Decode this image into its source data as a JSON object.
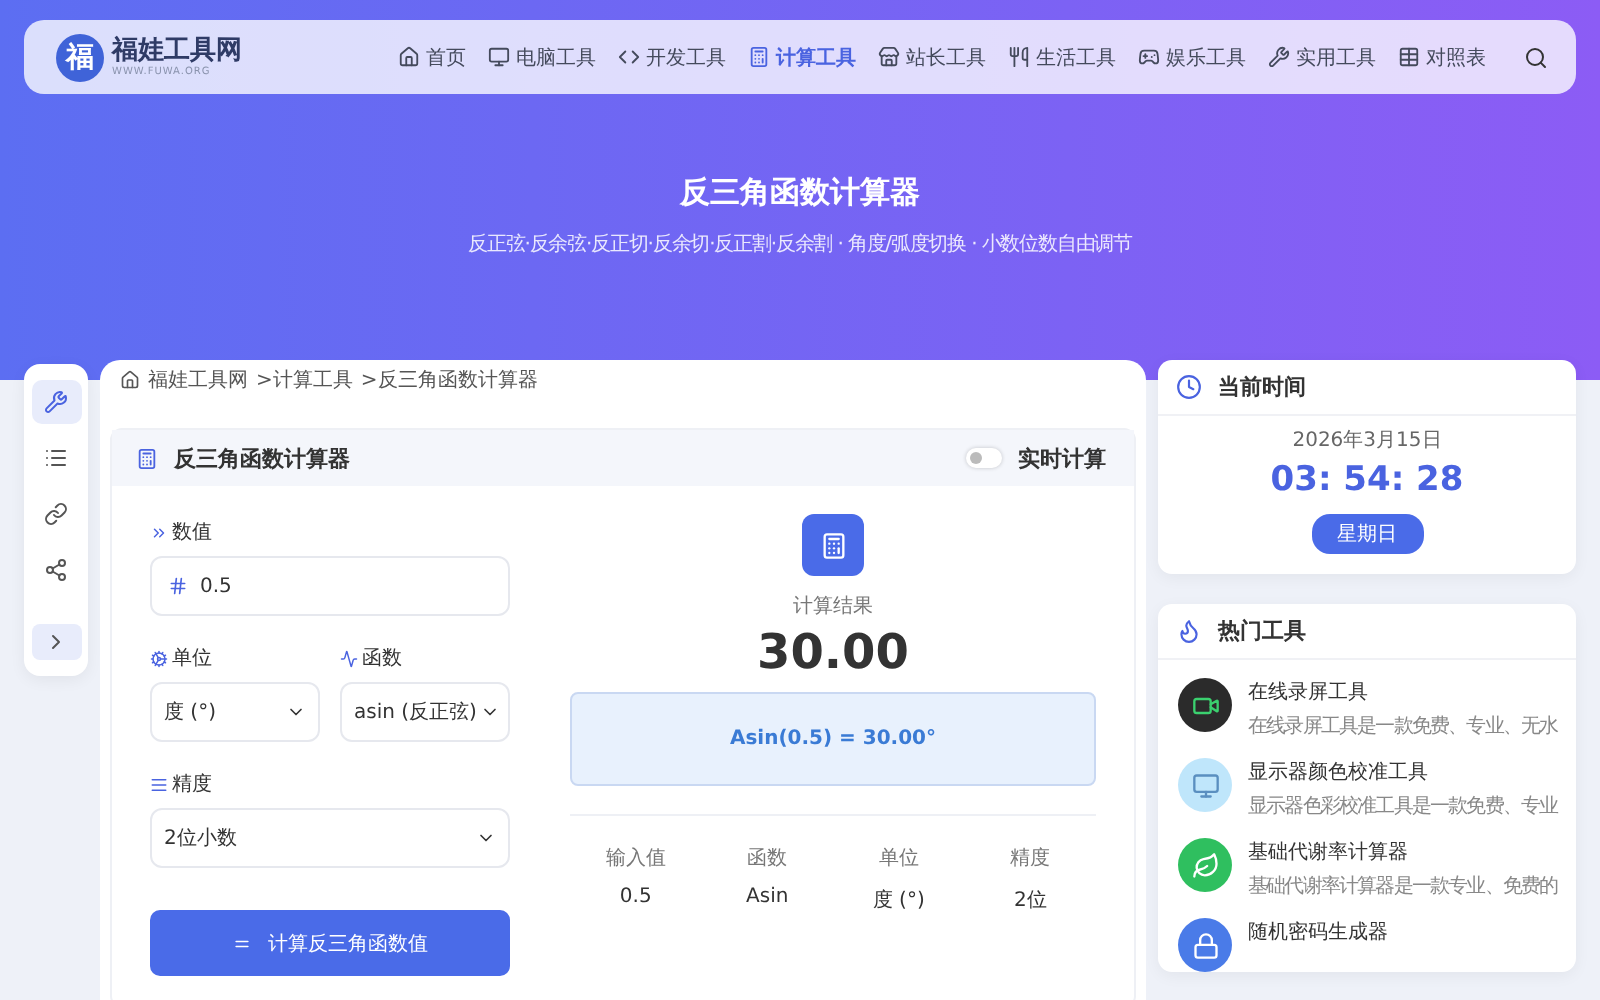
{
  "site": {
    "logo_char": "福",
    "name": "福娃工具网",
    "domain": "WWW.FUWA.ORG"
  },
  "nav": [
    {
      "label": "首页",
      "kind": "home",
      "selected": false
    },
    {
      "label": "电脑工具",
      "kind": "monitor",
      "selected": false
    },
    {
      "label": "开发工具",
      "kind": "code",
      "selected": false
    },
    {
      "label": "计算工具",
      "kind": "calculator",
      "selected": true
    },
    {
      "label": "站长工具",
      "kind": "store",
      "selected": false
    },
    {
      "label": "生活工具",
      "kind": "utensils",
      "selected": false
    },
    {
      "label": "娱乐工具",
      "kind": "gamepad",
      "selected": false
    },
    {
      "label": "实用工具",
      "kind": "wrench",
      "selected": false
    },
    {
      "label": "对照表",
      "kind": "table",
      "selected": false
    }
  ],
  "hero": {
    "title": "反三角函数计算器",
    "subtitle": "反正弦·反余弦·反正切·反余切·反正割·反余割 · 角度/弧度切换 · 小数位数自由调节"
  },
  "side_rail": [
    {
      "kind": "tools",
      "selected": true
    },
    {
      "kind": "list",
      "selected": false
    },
    {
      "kind": "link",
      "selected": false
    },
    {
      "kind": "share",
      "selected": false
    }
  ],
  "breadcrumb": [
    "福娃工具网",
    ">计算工具",
    ">反三角函数计算器"
  ],
  "calculator": {
    "title": "反三角函数计算器",
    "realtime": {
      "label": "实时计算",
      "on": false
    },
    "value_field": {
      "label": "数值",
      "value": "0.5"
    },
    "unit_field": {
      "label": "单位",
      "value": "度 (°)"
    },
    "function_field": {
      "label": "函数",
      "value": "asin (反正弦)"
    },
    "precision_field": {
      "label": "精度",
      "value": "2位小数"
    },
    "submit": "计算反三角函数值",
    "result_label": "计算结果",
    "result": "30.00",
    "formula": "Asin(0.5) = 30.00°",
    "summary": [
      {
        "label": "输入值",
        "value": "0.5"
      },
      {
        "label": "函数",
        "value": "Asin"
      },
      {
        "label": "单位",
        "value": "度 (°)"
      },
      {
        "label": "精度",
        "value": "2位"
      }
    ]
  },
  "clock": {
    "title": "当前时间",
    "date": "2026年3月15日",
    "time": "03: 54: 28",
    "weekday": "星期日"
  },
  "hot_tools": {
    "title": "热门工具",
    "items": [
      {
        "kind": "video",
        "name": "在线录屏工具",
        "desc": "在线录屏工具是一款免费、专业、无水"
      },
      {
        "kind": "monitor",
        "name": "显示器颜色校准工具",
        "desc": "显示器色彩校准工具是一款免费、专业"
      },
      {
        "kind": "leaf",
        "name": "基础代谢率计算器",
        "desc": "基础代谢率计算器是一款专业、免费的"
      },
      {
        "kind": "lock",
        "name": "随机密码生成器"
      }
    ]
  }
}
